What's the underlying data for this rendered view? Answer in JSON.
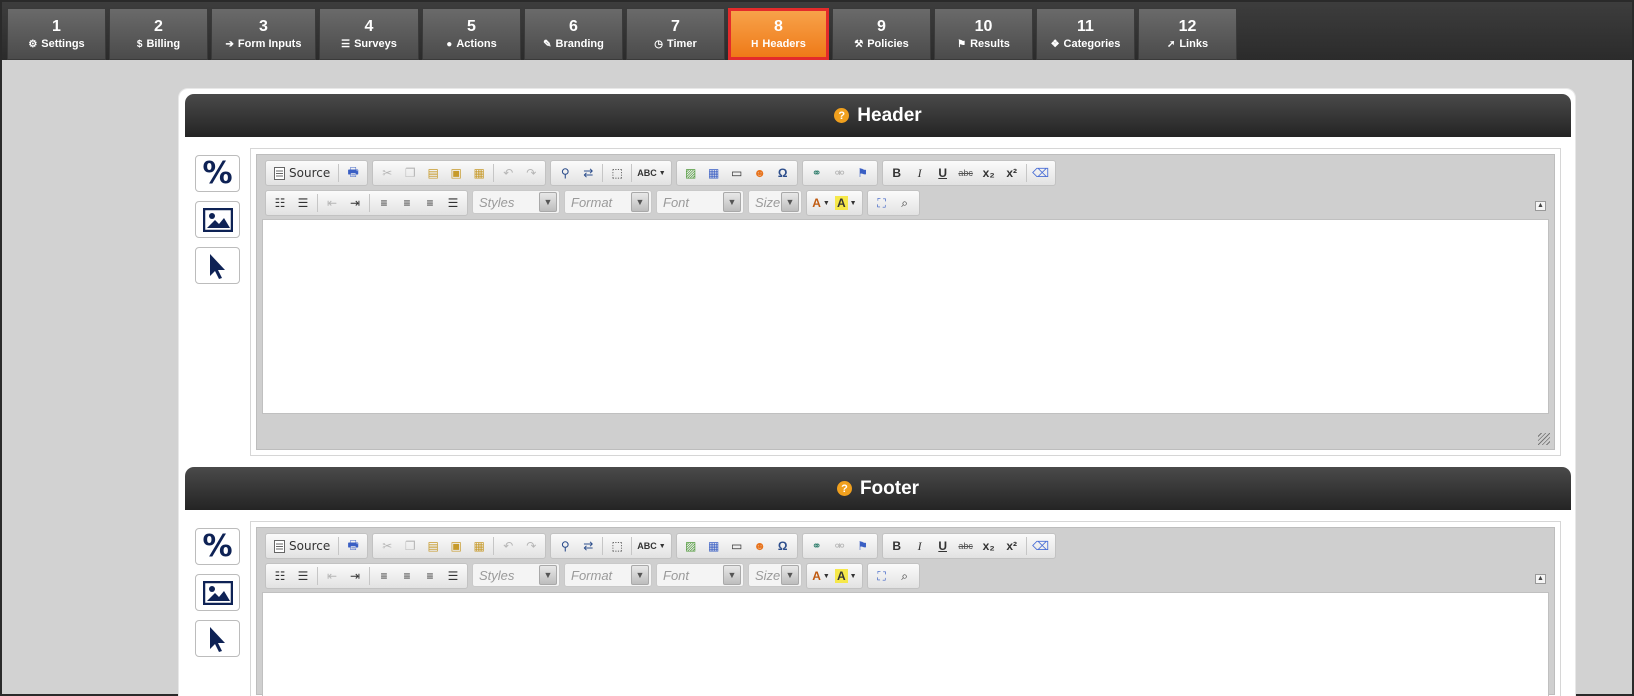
{
  "tabs": [
    {
      "num": "1",
      "label": "Settings",
      "icon": "gear-icon",
      "glyph": "⚙"
    },
    {
      "num": "2",
      "label": "Billing",
      "icon": "dollar-icon",
      "glyph": "$"
    },
    {
      "num": "3",
      "label": "Form Inputs",
      "icon": "sign-in-icon",
      "glyph": "➔"
    },
    {
      "num": "4",
      "label": "Surveys",
      "icon": "list-icon",
      "glyph": "☰"
    },
    {
      "num": "5",
      "label": "Actions",
      "icon": "user-icon",
      "glyph": "●"
    },
    {
      "num": "6",
      "label": "Branding",
      "icon": "brush-icon",
      "glyph": "✎"
    },
    {
      "num": "7",
      "label": "Timer",
      "icon": "clock-icon",
      "glyph": "◷"
    },
    {
      "num": "8",
      "label": "Headers",
      "icon": "header-icon",
      "glyph": "H",
      "active": true
    },
    {
      "num": "9",
      "label": "Policies",
      "icon": "gavel-icon",
      "glyph": "⚒"
    },
    {
      "num": "10",
      "label": "Results",
      "icon": "flag-icon",
      "glyph": "⚑"
    },
    {
      "num": "11",
      "label": "Categories",
      "icon": "cubes-icon",
      "glyph": "❖"
    },
    {
      "num": "12",
      "label": "Links",
      "icon": "pointer-icon",
      "glyph": "➚"
    }
  ],
  "sections": {
    "header": {
      "title": "Header",
      "help": "?"
    },
    "footer": {
      "title": "Footer",
      "help": "?"
    }
  },
  "side_buttons": {
    "percent": "%",
    "image": "image",
    "pointer": "pointer"
  },
  "toolbar": {
    "source_label": "Source",
    "styles_placeholder": "Styles",
    "format_placeholder": "Format",
    "font_placeholder": "Font",
    "size_placeholder": "Size",
    "bold": "B",
    "italic": "I",
    "underline": "U",
    "strike": "abc",
    "subscript": "x₂",
    "superscript": "x²",
    "omega": "Ω",
    "spellcheck": "ABC",
    "text_color": "A",
    "bg_color": "A"
  },
  "colors": {
    "active_tab": "#ef7a18",
    "active_border": "#e32b2b",
    "help_icon": "#f0a01e",
    "side_icon": "#0e2255"
  }
}
